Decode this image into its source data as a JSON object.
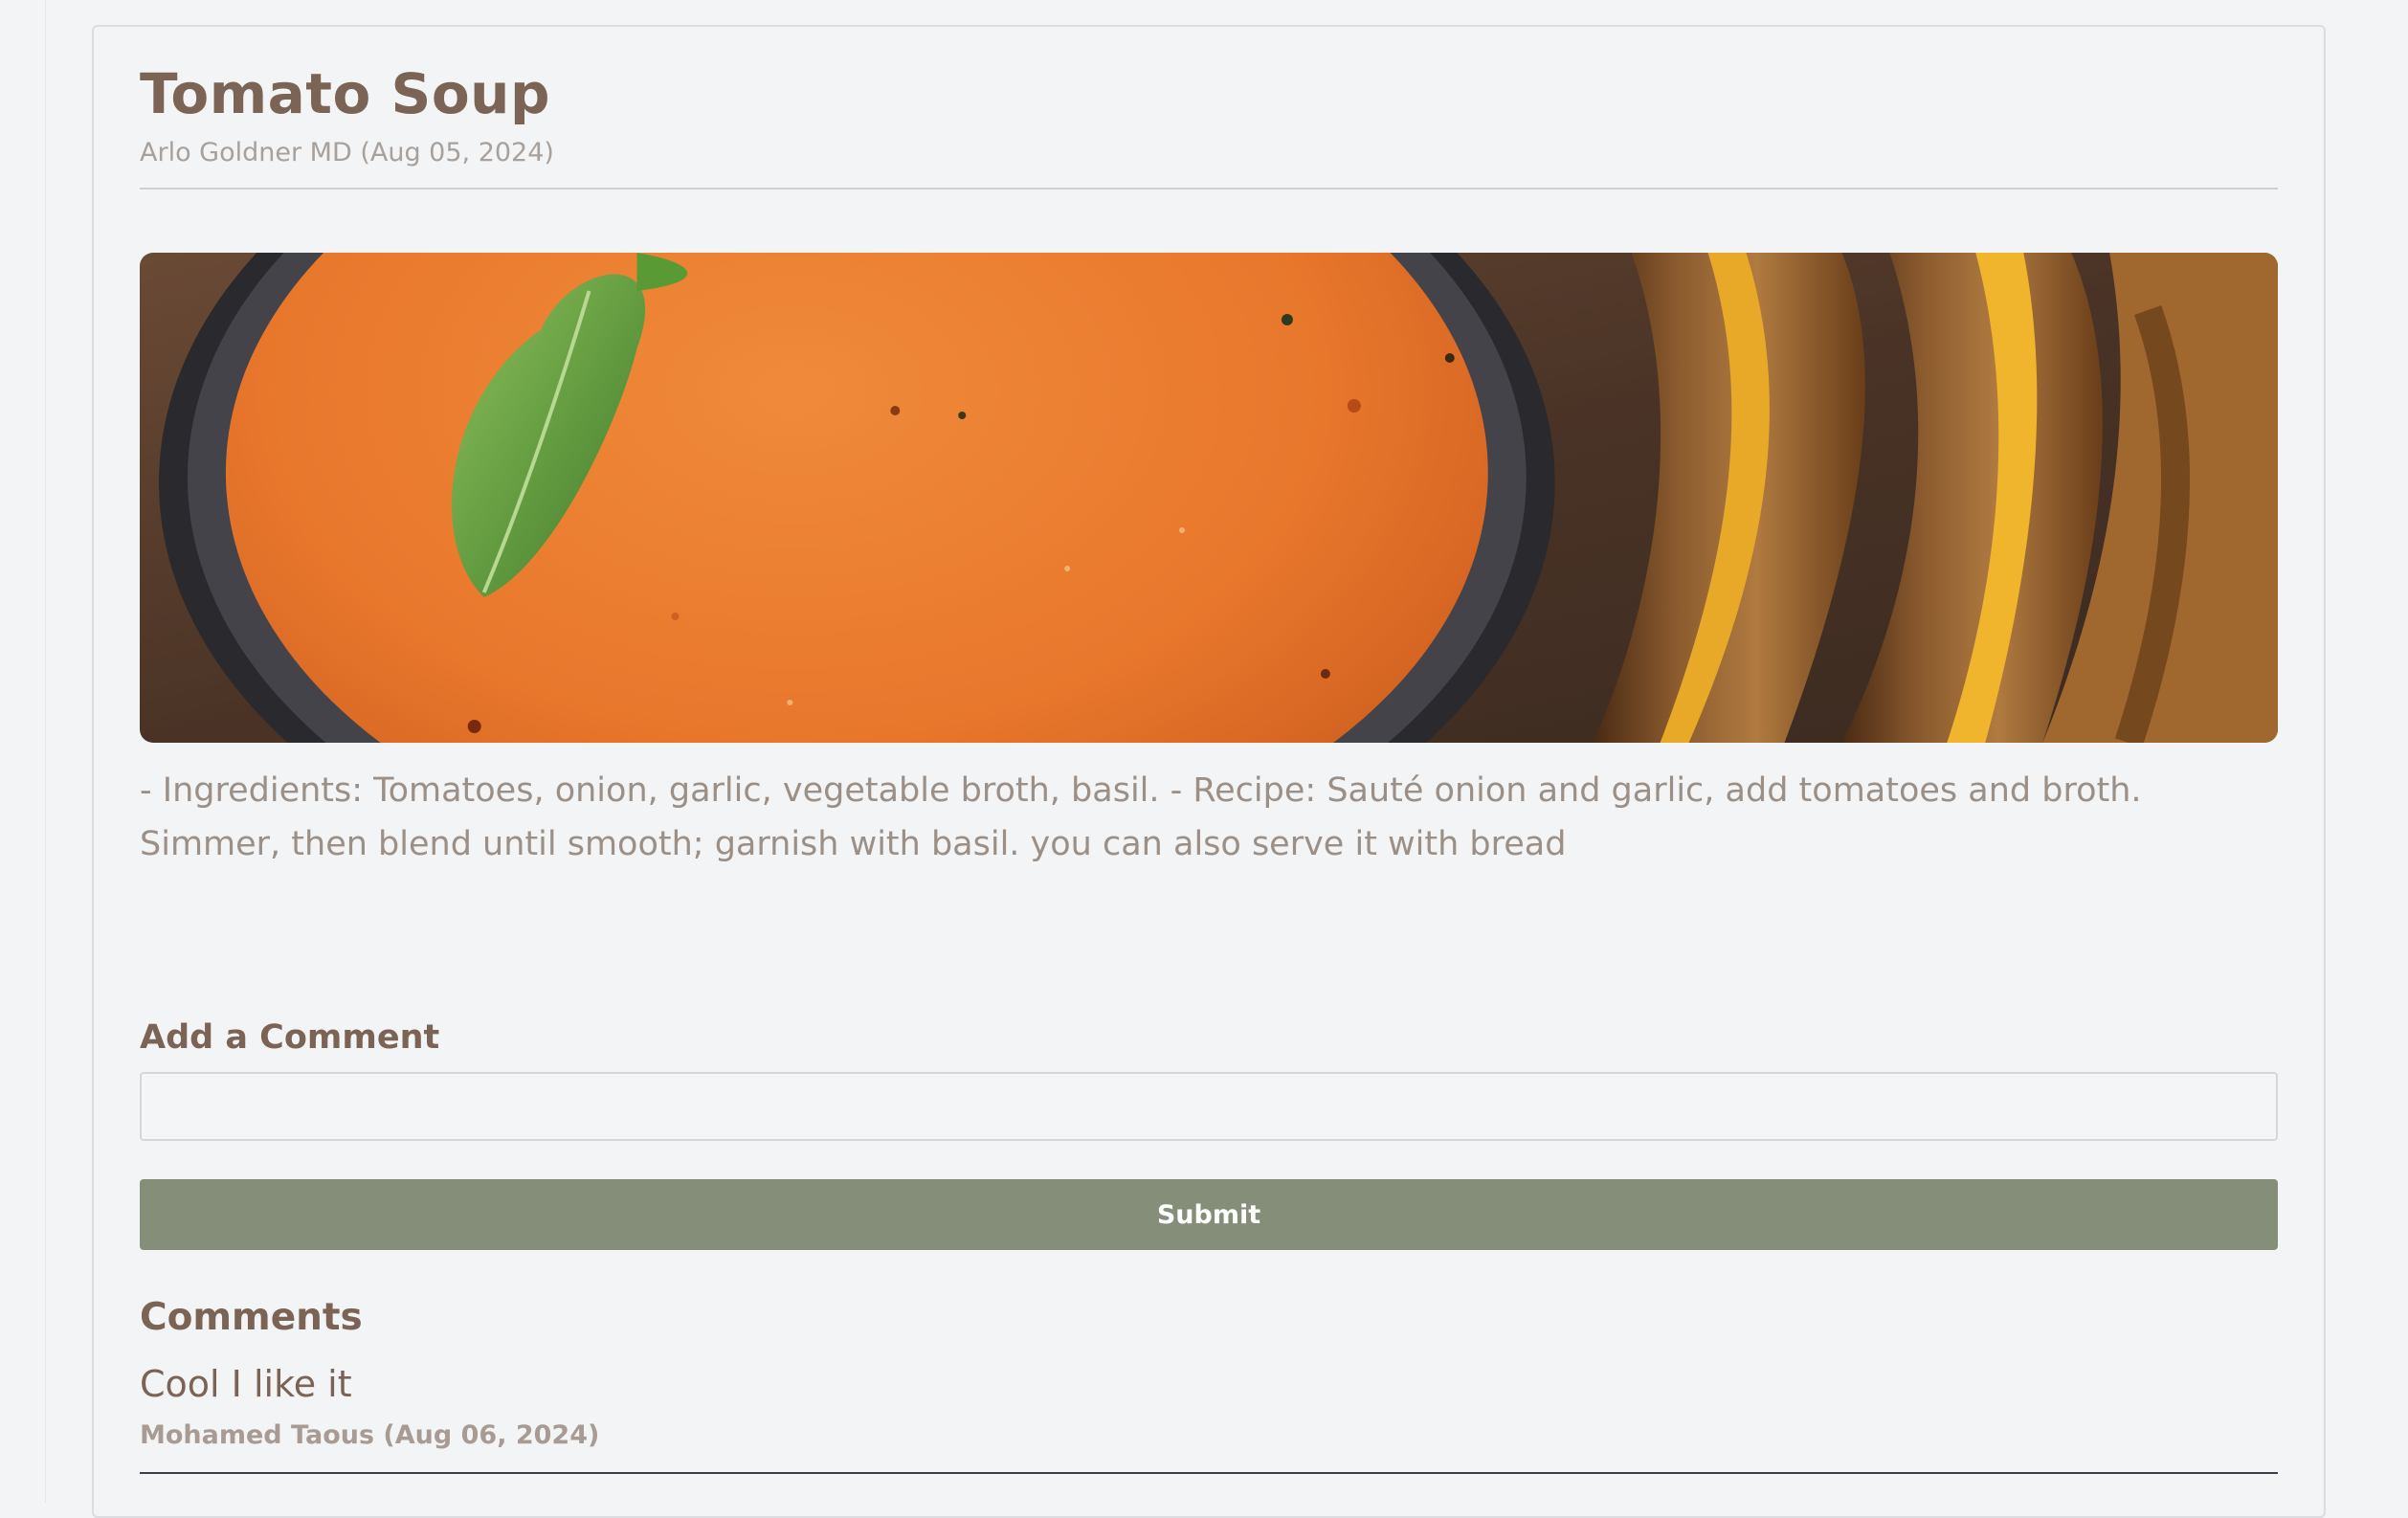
{
  "post": {
    "title": "Tomato Soup",
    "byline": "Arlo Goldner MD (Aug 05, 2024)",
    "image": {
      "subject": "tomato soup with basil and grilled cheese toast"
    },
    "body": "- Ingredients: Tomatoes, onion, garlic, vegetable broth, basil. - Recipe: Sauté onion and garlic, add tomatoes and broth. Simmer, then blend until smooth; garnish with basil. you can also serve it with bread"
  },
  "comment_form": {
    "label": "Add a Comment",
    "value": "",
    "placeholder": "",
    "submit_label": "Submit"
  },
  "comments": {
    "heading": "Comments",
    "items": [
      {
        "text": "Cool I like it",
        "meta": "Mohamed Taous (Aug 06, 2024)"
      }
    ]
  },
  "colors": {
    "title": "#7b6356",
    "muted_text": "#9b8f86",
    "submit_button": "#848e79",
    "background": "#f3f4f6"
  }
}
